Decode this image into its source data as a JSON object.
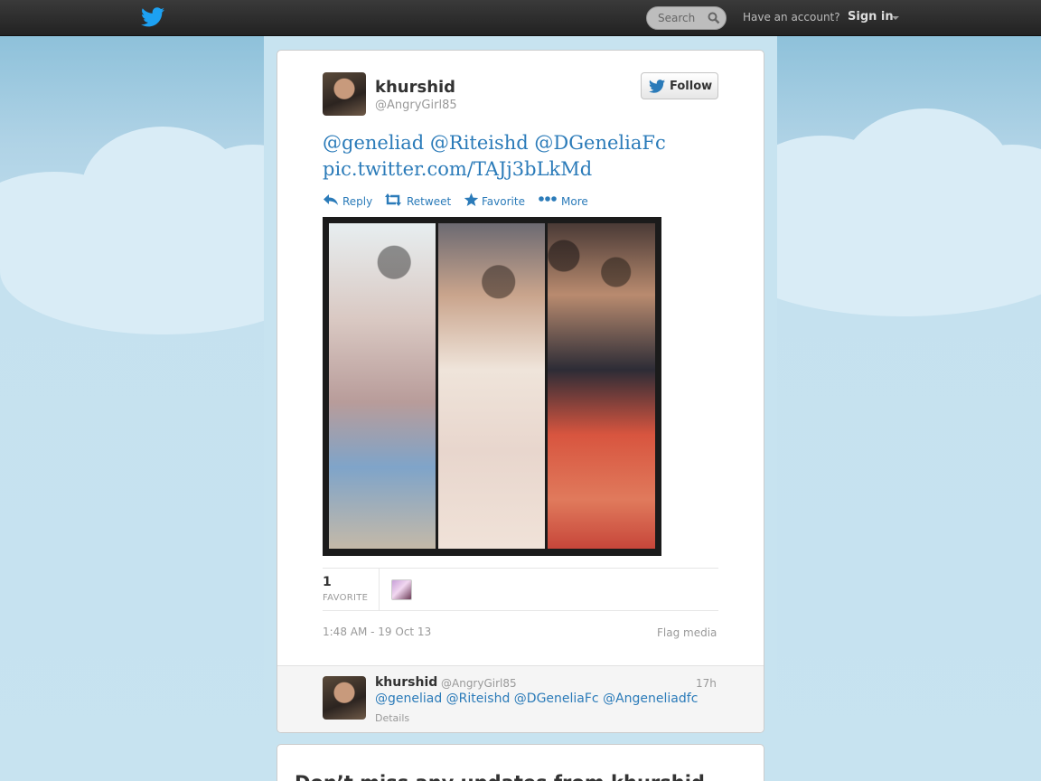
{
  "topbar": {
    "search_placeholder": "Search",
    "have_account": "Have an account?",
    "signin_label": "Sign in"
  },
  "tweet": {
    "author_name": "khurshid",
    "author_handle": "@AngryGirl85",
    "follow_label": "Follow",
    "text_line1": "@geneliad @Riteishd @DGeneliaFc",
    "text_line2": "pic.twitter.com/TAJj3bLkMd",
    "actions": {
      "reply": "Reply",
      "retweet": "Retweet",
      "favorite": "Favorite",
      "more": "More"
    },
    "favorites_count": "1",
    "favorites_label": "FAVORITE",
    "timestamp": "1:48 AM - 19 Oct 13",
    "flag_label": "Flag media"
  },
  "reply": {
    "name": "khurshid",
    "handle": "@AngryGirl85",
    "time": "17h",
    "text": "@geneliad @Riteishd @DGeneliaFc @Angeneliadfc",
    "details": "Details"
  },
  "signup_card": {
    "title": "Don’t miss any updates from khurshid"
  },
  "colors": {
    "link": "#2b7bb9",
    "topbar": "#2a2a2a",
    "background": "#c0deed"
  }
}
